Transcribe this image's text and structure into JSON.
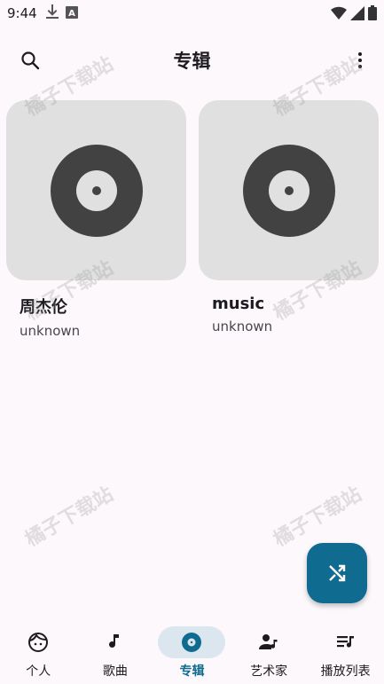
{
  "status_bar": {
    "time": "9:44",
    "icons_left": [
      "download-icon",
      "a-icon"
    ],
    "icons_right": [
      "wifi-icon",
      "signal-icon",
      "battery-icon"
    ]
  },
  "header": {
    "title": "专辑",
    "search_icon": "search-icon",
    "more_icon": "more-vertical-icon"
  },
  "albums": [
    {
      "name": "周杰伦",
      "artist": "unknown",
      "cover_icon": "vinyl-icon"
    },
    {
      "name": "music",
      "artist": "unknown",
      "cover_icon": "vinyl-icon"
    }
  ],
  "watermark": "橘子下载站",
  "fab": {
    "icon": "shuffle-icon",
    "color": "#0f6b8f"
  },
  "bottom_nav": {
    "items": [
      {
        "label": "个人",
        "icon": "face-icon"
      },
      {
        "label": "歌曲",
        "icon": "music-note-icon"
      },
      {
        "label": "专辑",
        "icon": "album-icon",
        "active": true
      },
      {
        "label": "艺术家",
        "icon": "artist-icon"
      },
      {
        "label": "播放列表",
        "icon": "playlist-icon"
      }
    ]
  },
  "colors": {
    "accent": "#0f6b8f",
    "background": "#fdf8fc",
    "cover_bg": "#e0e0e0",
    "vinyl": "#424242",
    "active_pill": "#dbe6ee"
  }
}
